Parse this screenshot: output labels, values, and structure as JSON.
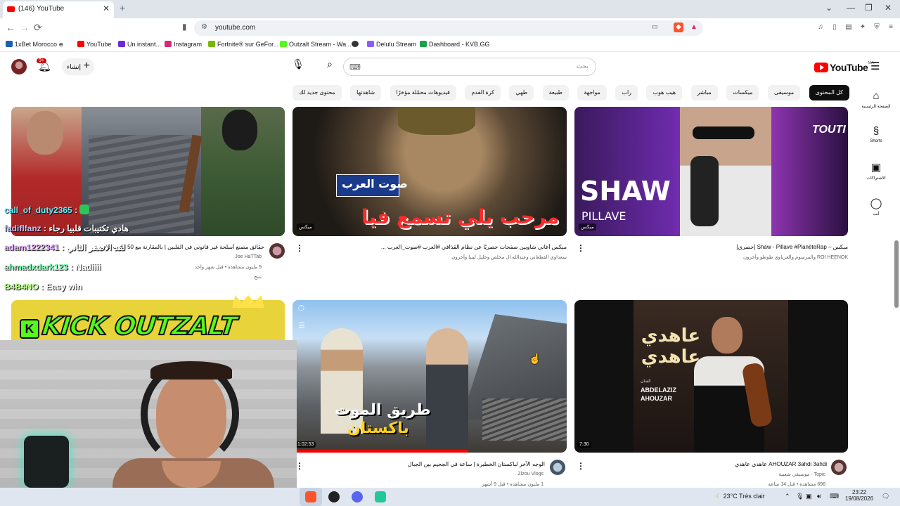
{
  "browser": {
    "tab_title": "(146) YouTube",
    "tab_close": "✕",
    "new_tab": "+",
    "window_controls": [
      "⌄",
      "—",
      "❐",
      "✕"
    ],
    "url": "youtube.com",
    "nav": {
      "back": "←",
      "forward": "→",
      "reload": "⟳"
    },
    "bookmarks": [
      {
        "label": "1xBet Morocco",
        "color": "#1a5fb4"
      },
      {
        "label": "YouTube",
        "color": "#ff0000"
      },
      {
        "label": "Un instant...",
        "color": "#6d28d9"
      },
      {
        "label": "Instagram",
        "color": "#d62976"
      },
      {
        "label": "Fortnite® sur GeFor...",
        "color": "#76b900"
      },
      {
        "label": "Outzalt Stream - Wa...",
        "color": "#53fc18"
      },
      {
        "label": "Delulu Stream",
        "color": "#8b5cf6"
      },
      {
        "label": "Dashboard - KVB.GG",
        "color": "#16a34a"
      }
    ]
  },
  "youtube": {
    "logo_text": "YouTube",
    "logo_sup": "MA",
    "search_placeholder": "بحث",
    "create_label": "إنشاء",
    "notification_count": "9+",
    "chips": [
      {
        "label": "كل المحتوى",
        "active": true
      },
      {
        "label": "موسيقى"
      },
      {
        "label": "ميكسات"
      },
      {
        "label": "مباشر"
      },
      {
        "label": "هيب هوب"
      },
      {
        "label": "راب"
      },
      {
        "label": "مواجهة"
      },
      {
        "label": "طبيعة"
      },
      {
        "label": "طهي"
      },
      {
        "label": "كرة القدم"
      },
      {
        "label": "فيديوهات محمّلة مؤخرًا"
      },
      {
        "label": "شاهدتها"
      },
      {
        "label": "محتوى جديد لك"
      }
    ],
    "guide": [
      {
        "label": "الصفحة الرئيسية",
        "icon": "⌂"
      },
      {
        "label": "Shorts",
        "icon": "§"
      },
      {
        "label": "الاشتراكات",
        "icon": "▣"
      },
      {
        "label": "أنت",
        "icon": "◯"
      }
    ]
  },
  "videos": {
    "v1": {
      "title": "حقائق مصنع أسلحة غير قانوني في الفلبين | بالمقارنة مع 50 قلوب نوع ملك الشارع",
      "channel": "Joe HaTTab",
      "stats": "9 مليون مشاهدة • قبل شهر واحد",
      "badge": "تنتج"
    },
    "v2": {
      "title": "ميكس أغاني شاويين صفحات حصريًا عن نظام القذافي #العرب #صوت_العرب ...",
      "channel": "سعداوي القطعاني وعبدالله ال مخلص وخليل ليبيا وآخرون",
      "overlay_top": "صوت العرب",
      "overlay_main": "مرحب يلي تسمع فيا",
      "mix_label": "ميكس"
    },
    "v3": {
      "title": "ميكس – Shaw - Pillave #PlanèteRap [حصري]",
      "channel": "ROI HEENOK والمرسوم والغرباوي طوطو وآخرون",
      "overlay_main": "SHAW",
      "overlay_sub": "PILLAVE",
      "overlay_brand": "TOUTI",
      "mix_label": "ميكس"
    },
    "v4": {
      "title": "الوجه الآخر لباكستان الخطيرة | ساعة في الجحيم بين الجبال",
      "channel": "Zizou Vlogs",
      "stats": "1 مليون مشاهدة • قبل 9 أشهر",
      "duration": "1:02:53",
      "overlay_main": "طريق الموت",
      "overlay_sub": "باكستان"
    },
    "v5": {
      "title": "AHOUZAR 3ahdi 3ahdi عاهدي عاهدي",
      "channel": "Topic - موسيقى شعبية",
      "stats": "696 مشاهدة • قبل 14 ساعة",
      "duration": "7:30",
      "overlay_main": "عاهدي عاهدي",
      "overlay_name": "ABDELAZIZ AHOUZAR",
      "overlay_small": "الفنان"
    }
  },
  "stream_overlay": {
    "chat": [
      {
        "user": "call_of_duty2365",
        "text": ":",
        "color": "#5ef0ff"
      },
      {
        "user": "fadiflfanz",
        "text": ": هادي تكتيبات قلبيا رجاء",
        "color": "#c2c6ff"
      },
      {
        "user": "adam1222341",
        "text": ": لقد الاصفر الثاني",
        "color": "#e6a8ff"
      },
      {
        "user": "ahmadxdark123",
        "text": ": Nadiiii",
        "color": "#7dffb3"
      },
      {
        "user": "B4B4NO",
        "text": ": Easy win",
        "color": "#b7ff8a"
      }
    ],
    "kick_text": "KICK OUTZALT"
  },
  "taskbar": {
    "weather": "23°C  Très clair",
    "time": "23:22",
    "date": "19/08/2026"
  }
}
